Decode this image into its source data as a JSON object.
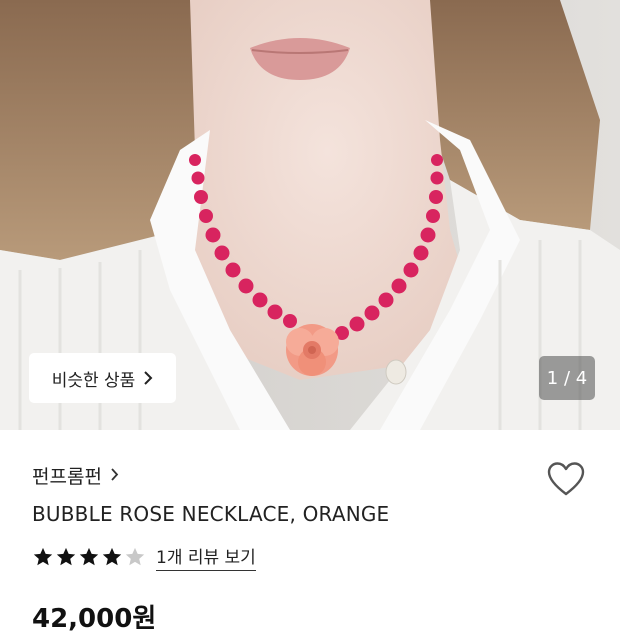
{
  "hero": {
    "image_description_icon": "model-wearing-necklace-photo",
    "similar_button_label": "비슷한 상품",
    "image_counter": "1 / 4"
  },
  "product": {
    "brand": "펀프롬펀",
    "name": "BUBBLE ROSE NECKLACE, ORANGE",
    "rating": 4,
    "rating_max": 5,
    "review_link": "1개 리뷰 보기",
    "price": "42,000원"
  },
  "colors": {
    "star_filled": "#111111",
    "star_empty": "#c8c8c8",
    "heart_stroke": "#555555"
  }
}
